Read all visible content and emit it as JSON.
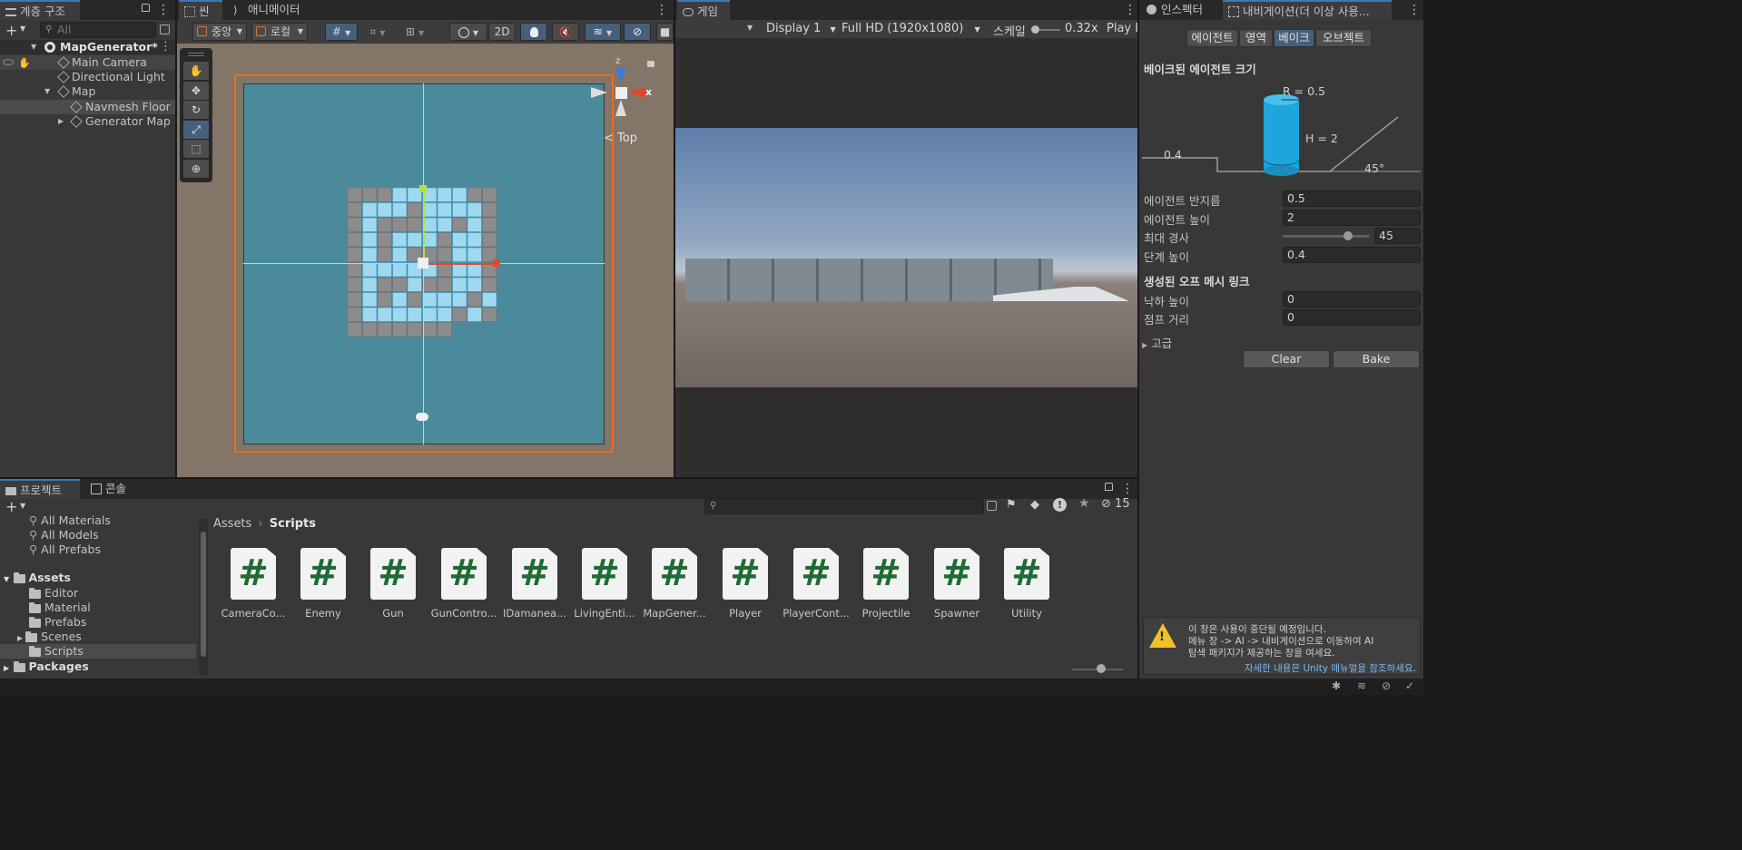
{
  "hierarchy": {
    "tab_label": "계층 구조",
    "search_placeholder": "All",
    "scene_name": "MapGenerator*",
    "items": [
      {
        "label": "Main Camera"
      },
      {
        "label": "Directional Light"
      },
      {
        "label": "Map"
      },
      {
        "label": "Navmesh Floor"
      },
      {
        "label": "Generator Map"
      }
    ]
  },
  "scene": {
    "tab_label": "씬",
    "animator_tab_label": "애니메이터",
    "pivot_label": "중앙",
    "space_label": "로컬",
    "mode_2d": "2D",
    "gizmo_view_label": "Top",
    "gizmo_axis_x": "x",
    "gizmo_axis_z": "z"
  },
  "game": {
    "tab_label": "게임",
    "display": "Display 1",
    "resolution": "Full HD (1920x1080)",
    "scale_label": "스케일",
    "scale_value": "0.32x",
    "play_label": "Play F"
  },
  "inspector": {
    "tab_label": "인스펙터",
    "nav_tab_label": "내비게이션(더 이상 사용...",
    "subtabs": [
      {
        "label": "에이전트"
      },
      {
        "label": "영역"
      },
      {
        "label": "베이크"
      },
      {
        "label": "오브젝트"
      }
    ],
    "baked_size_header": "베이크된 에이전트 크기",
    "diagram": {
      "r": "R = 0.5",
      "h": "H = 2",
      "step": "0.4",
      "angle": "45°"
    },
    "fields": {
      "agent_radius_label": "에이전트 반지름",
      "agent_radius": "0.5",
      "agent_height_label": "에이전트 높이",
      "agent_height": "2",
      "max_slope_label": "최대 경사",
      "max_slope": "45",
      "max_slope_fraction": 0.75,
      "step_height_label": "단계 높이",
      "step_height": "0.4"
    },
    "offmesh_header": "생성된 오프 메시 링크",
    "drop_height_label": "낙하 높이",
    "drop_height": "0",
    "jump_distance_label": "점프 거리",
    "jump_distance": "0",
    "advanced_label": "고급",
    "clear_label": "Clear",
    "bake_label": "Bake",
    "warning_lines": [
      "이 창은 사용이 중단될 예정입니다.",
      "메뉴 창 -> AI -> 내비게이션으로 이동하여 AI",
      "탐색 패키지가 제공하는 창을 여세요."
    ],
    "warning_link": "자세한 내용은 Unity 매뉴얼을 참조하세요."
  },
  "project": {
    "tab_label": "프로젝트",
    "console_tab_label": "콘솔",
    "favorites": [
      {
        "label": "All Materials"
      },
      {
        "label": "All Models"
      },
      {
        "label": "All Prefabs"
      }
    ],
    "assets_label": "Assets",
    "folders": [
      {
        "label": "Editor"
      },
      {
        "label": "Material"
      },
      {
        "label": "Prefabs"
      },
      {
        "label": "Scenes"
      },
      {
        "label": "Scripts"
      }
    ],
    "packages_label": "Packages",
    "breadcrumb_root": "Assets",
    "breadcrumb_current": "Scripts",
    "hidden_count": "15",
    "scripts": [
      {
        "label": "CameraCo..."
      },
      {
        "label": "Enemy"
      },
      {
        "label": "Gun"
      },
      {
        "label": "GunContro..."
      },
      {
        "label": "IDamanea..."
      },
      {
        "label": "LivingEnti..."
      },
      {
        "label": "MapGener..."
      },
      {
        "label": "Player"
      },
      {
        "label": "PlayerCont..."
      },
      {
        "label": "Projectile"
      },
      {
        "label": "Spawner"
      },
      {
        "label": "Utility"
      }
    ]
  },
  "colors": {
    "accent": "#3a79bb",
    "floor": "#4b8a9a",
    "walkable": "#9fd9f0",
    "selection_outline": "#f26a1b",
    "cylinder": "#1ea6dc"
  }
}
